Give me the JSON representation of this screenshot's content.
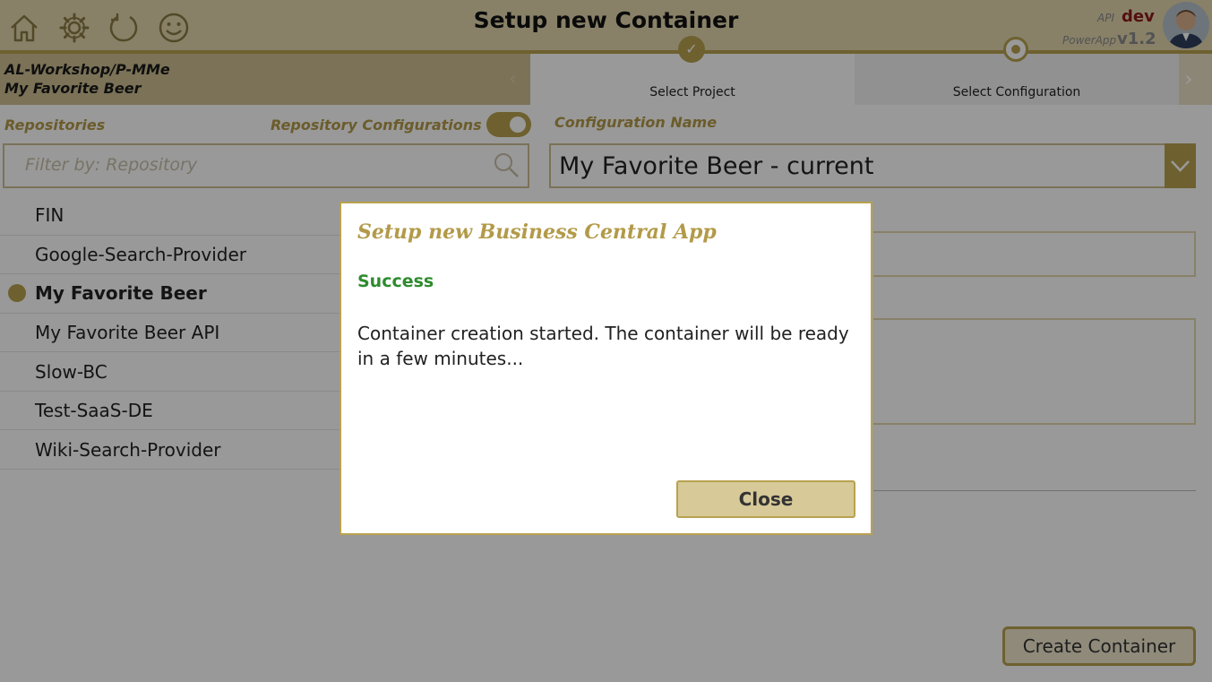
{
  "header": {
    "title": "Setup new Container",
    "api_label": "API",
    "api_value": "dev",
    "powerapp_label": "PowerApp",
    "version": "v1.2",
    "icons": [
      "home-icon",
      "gear-icon",
      "refresh-icon",
      "smiley-icon"
    ]
  },
  "breadcrumb": {
    "line1": "AL-Workshop/P-MMe",
    "line2": "My Favorite Beer"
  },
  "steps": [
    {
      "label": "Select Project",
      "state": "done"
    },
    {
      "label": "Select Configuration",
      "state": "current"
    }
  ],
  "left": {
    "repositories_label": "Repositories",
    "repo_configs_label": "Repository Configurations",
    "toggle_on": true,
    "filter_placeholder": "Filter by: Repository",
    "repos": [
      "FIN",
      "Google-Search-Provider",
      "My Favorite Beer",
      "My Favorite Beer API",
      "Slow-BC",
      "Test-SaaS-DE",
      "Wiki-Search-Provider"
    ],
    "selected_repo": "My Favorite Beer"
  },
  "right": {
    "config_name_label": "Configuration Name",
    "config_value": "My Favorite Beer - current",
    "create_button": "Create Container"
  },
  "dialog": {
    "title": "Setup new Business Central App",
    "status": "Success",
    "message": "Container creation started. The container will be ready in a few minutes...",
    "close_button": "Close"
  },
  "colors": {
    "accent": "#b8a24f",
    "header_bg": "#e3d7ae",
    "success": "#2e8b2e",
    "api_value": "#8b1a1a"
  }
}
